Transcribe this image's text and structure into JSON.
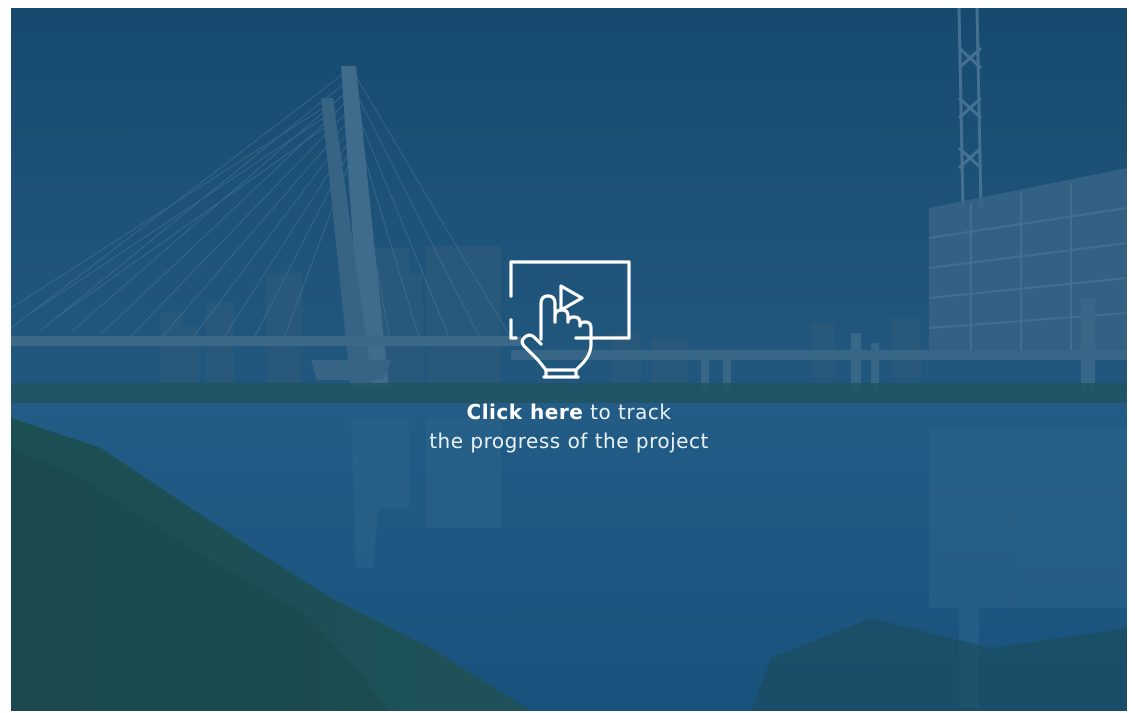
{
  "cta": {
    "strong": "Click here",
    "rest": " to track",
    "line2": "the progress of the project",
    "icon": "touch-screen-play-icon"
  },
  "theme": {
    "overlay": "#1d4f74",
    "text": "#ffffff"
  }
}
